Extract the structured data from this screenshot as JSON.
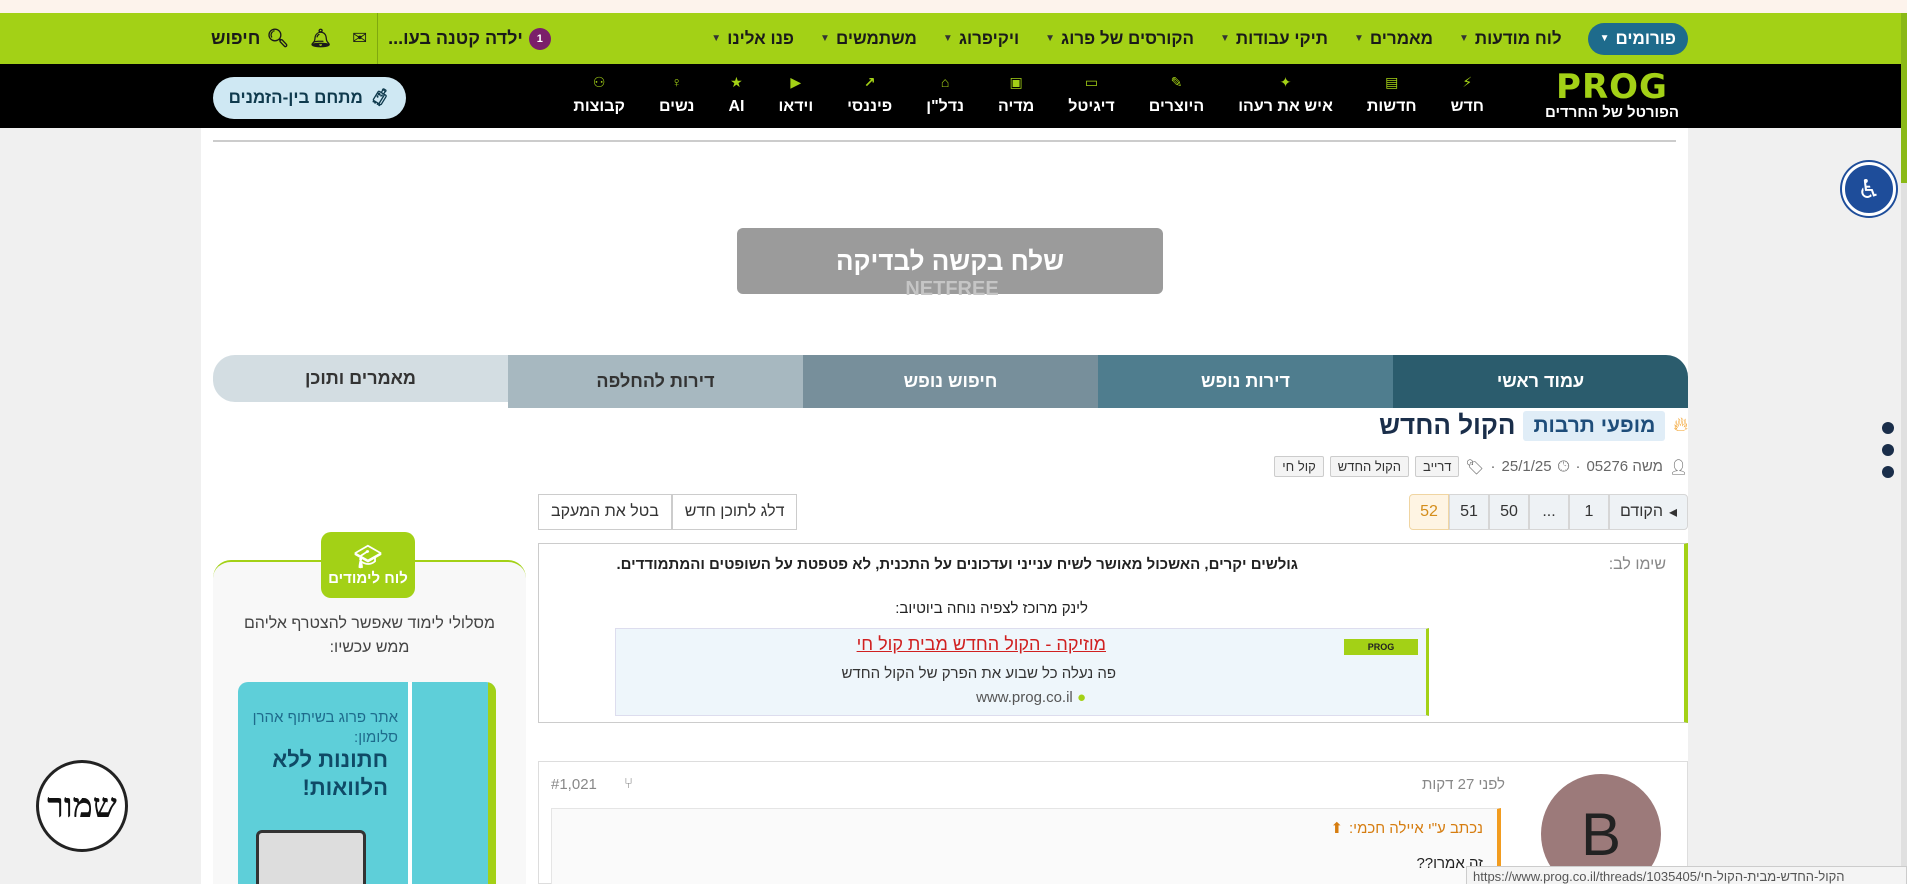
{
  "topnav": {
    "items": [
      {
        "label": "פורומים",
        "active": true
      },
      {
        "label": "לוח מודעות"
      },
      {
        "label": "מאמרים"
      },
      {
        "label": "תיקי עבודות"
      },
      {
        "label": "הקורסים של פרוג"
      },
      {
        "label": "ויקיפרוג"
      },
      {
        "label": "משתמשים"
      },
      {
        "label": "פנו אלינו"
      }
    ],
    "notification_text": "ילדה קטנה בעו...",
    "notification_count": "1",
    "search_label": "חיפוש"
  },
  "logo": {
    "name": "PROG",
    "tagline": "הפורטל של החרדים"
  },
  "catnav": [
    {
      "label": "חדש",
      "icon": "bolt-icon"
    },
    {
      "label": "חדשות",
      "icon": "news-icon"
    },
    {
      "label": "איש את רעהו",
      "icon": "handshake-icon"
    },
    {
      "label": "היוצרים",
      "icon": "brush-icon"
    },
    {
      "label": "דיגיטל",
      "icon": "monitor-icon"
    },
    {
      "label": "מדיה",
      "icon": "image-icon"
    },
    {
      "label": "נדל\"ן",
      "icon": "house-icon"
    },
    {
      "label": "פיננסי",
      "icon": "chart-icon"
    },
    {
      "label": "וידאו",
      "icon": "play-icon"
    },
    {
      "label": "AI",
      "icon": "star-icon"
    },
    {
      "label": "נשים",
      "icon": "woman-icon"
    },
    {
      "label": "קבוצות",
      "icon": "group-icon"
    }
  ],
  "between_times": "מתחם בין-הזמנים",
  "netfree": {
    "button": "שלח בקשה לבדיקה",
    "logo": "NETFREE"
  },
  "tabs": [
    "עמוד ראשי",
    "דירות נופש",
    "חיפוש נופש",
    "דירות להחלפה",
    "מאמרים ותוכן"
  ],
  "thread": {
    "prefix": "מופעי תרבות",
    "title": "הקול החדש",
    "author": "משה 05276",
    "date": "25/1/25",
    "tags": [
      "דרייב",
      "הקול החדש",
      "קול חי"
    ]
  },
  "pager": {
    "prev": "הקודם",
    "pages": [
      "1",
      "...",
      "50",
      "51",
      "52"
    ]
  },
  "skip_new": "דלג לתוכן חדש",
  "unwatch": "בטל את המעקב",
  "notice": {
    "label": "שימו לב:",
    "line1": "גולשים יקרים, האשכול מאושר לשיח ענייני ועדכונים על התכנית, לא פטפטת על השופטים והמתמודדים.",
    "line2": "לינק מרוכז לצפיה נוחה ביוטיוב:",
    "card_title": "מוזיקה - הקול החדש מבית קול חי",
    "card_desc": "פה נעלה כל שבוע את הפרק של הקול החדש",
    "card_url": "www.prog.co.il",
    "card_logo": "PROG"
  },
  "post": {
    "avatar_letter": "B",
    "time": "לפני 27 דקות",
    "number": "#1,021",
    "quote_header": "נכתב ע\"י איילה חכמי:",
    "quote_body": "זה אמרו??"
  },
  "sidebar": {
    "head": "לוח לימודים",
    "text": "מסלולי לימוד שאפשר להצטרף אליהם ממש עכשיו:",
    "promo_small": "אתר פרוג בשיתוף אהרן סלומון:",
    "promo_big": "חתונות ללא הלוואות!"
  },
  "shamor": "שמור",
  "url_tooltip": "https://www.prog.co.il/threads/1035405/הקול-החדש-מבית-הקול-חי"
}
